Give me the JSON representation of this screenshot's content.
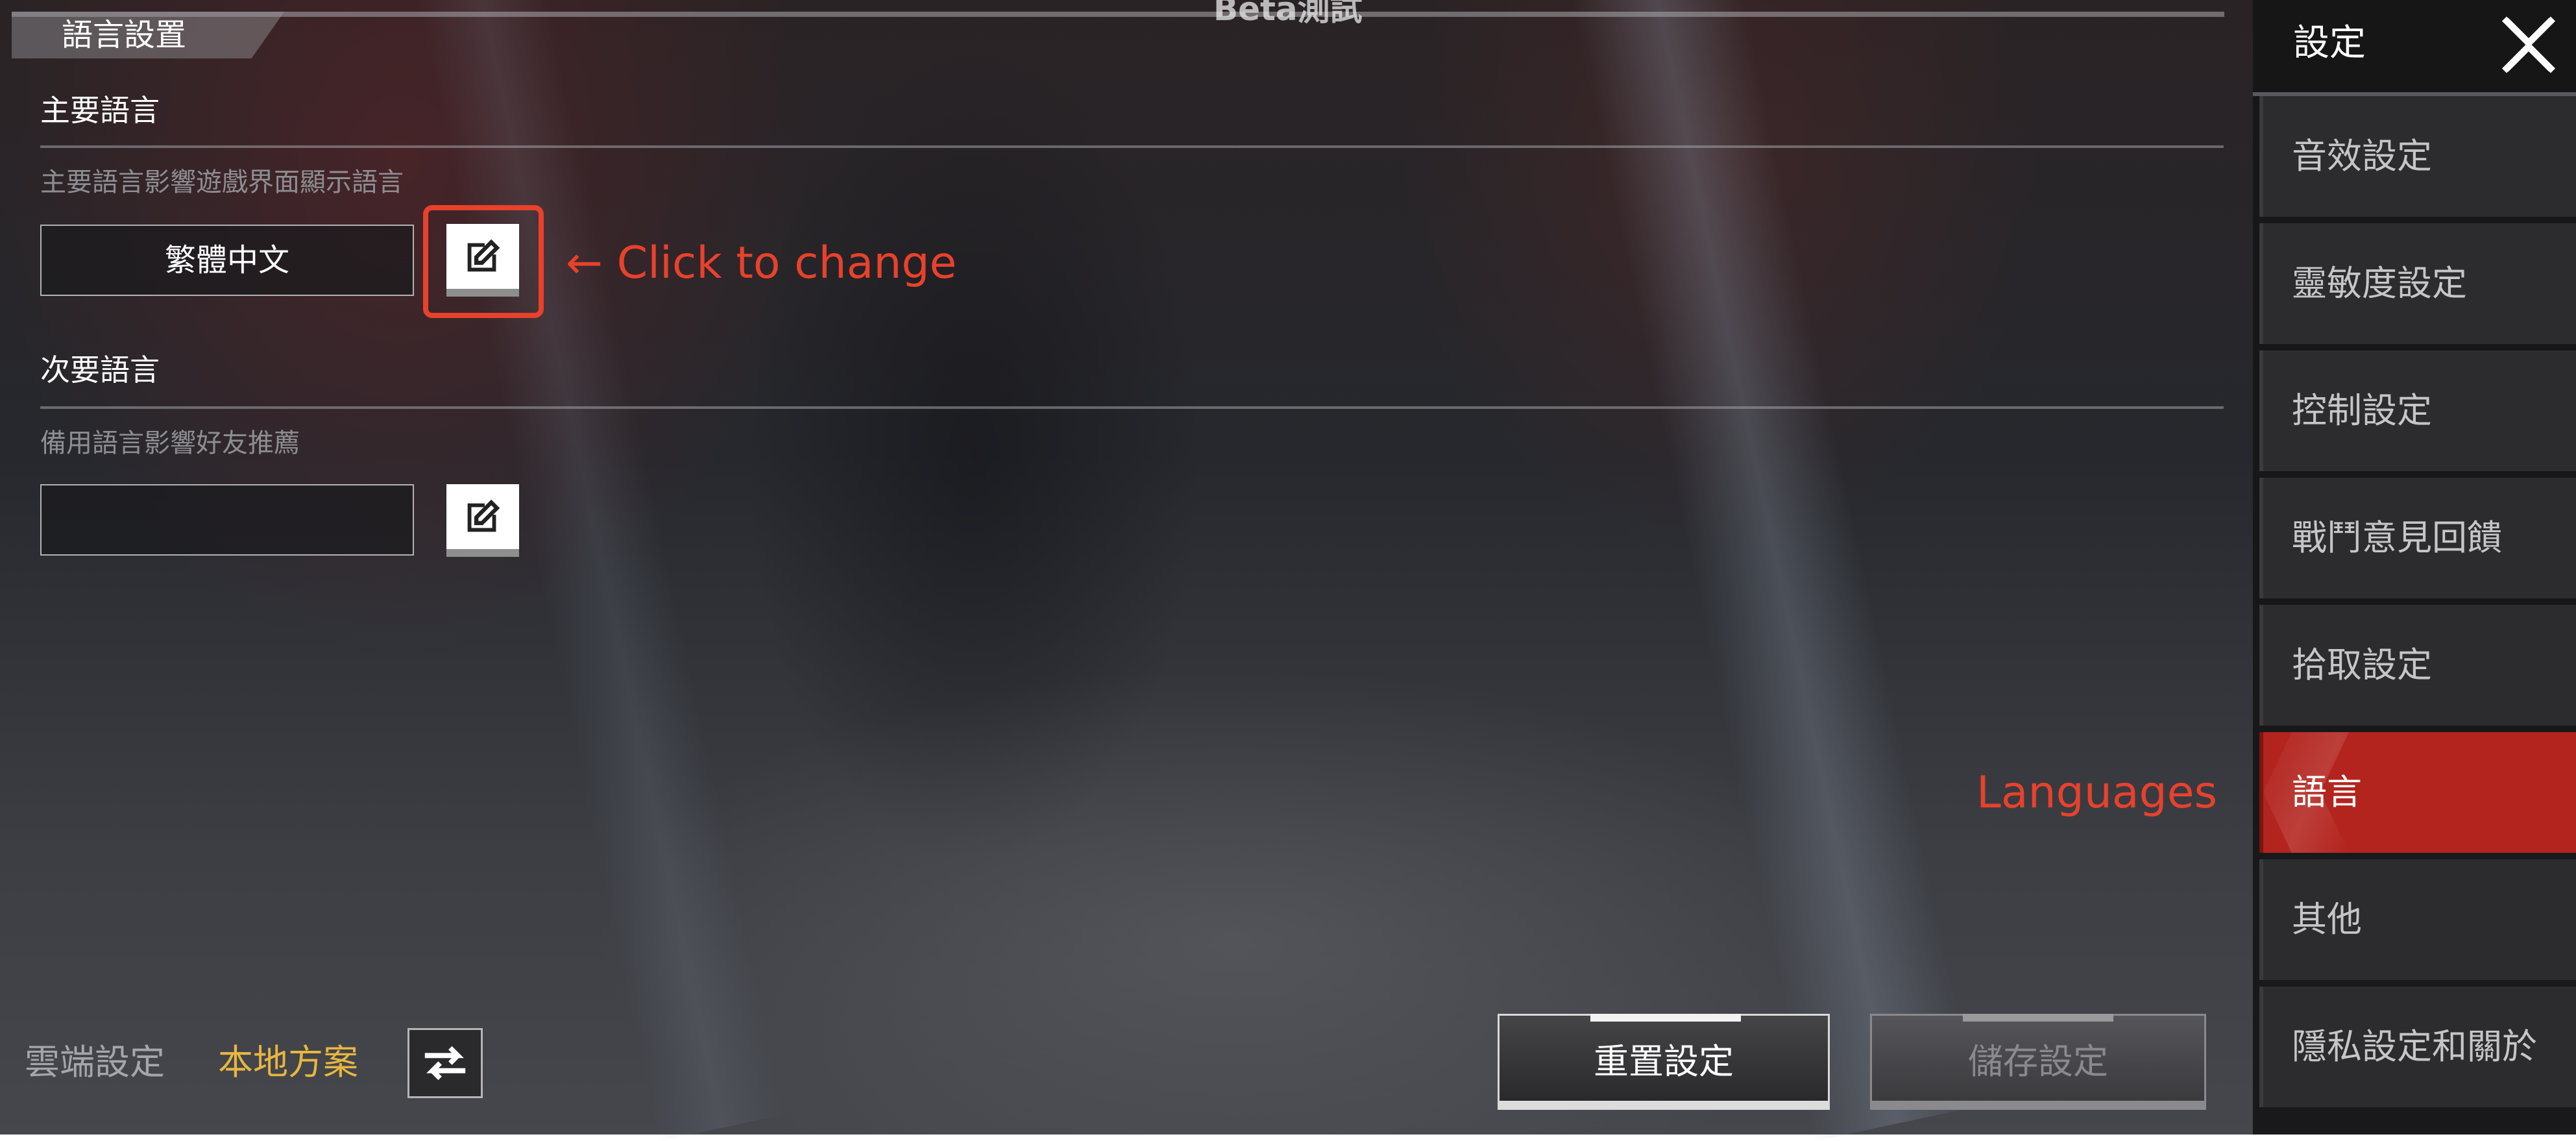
{
  "header": {
    "title": "語言設置",
    "beta_label": "Beta測試"
  },
  "primary_language": {
    "title": "主要語言",
    "description": "主要語言影響遊戲界面顯示語言",
    "value": "繁體中文"
  },
  "secondary_language": {
    "title": "次要語言",
    "description": "備用語言影響好友推薦",
    "value": ""
  },
  "annotations": {
    "click_to_change": "← Click to change",
    "languages": "Languages",
    "color": "#e8412c"
  },
  "bottom_bar": {
    "cloud_label": "雲端設定",
    "local_label": "本地方案",
    "reset_label": "重置設定",
    "save_label": "儲存設定"
  },
  "sidebar": {
    "title": "設定",
    "items": [
      {
        "label": "音效設定",
        "active": false
      },
      {
        "label": "靈敏度設定",
        "active": false
      },
      {
        "label": "控制設定",
        "active": false
      },
      {
        "label": "戰鬥意見回饋",
        "active": false
      },
      {
        "label": "拾取設定",
        "active": false
      },
      {
        "label": "語言",
        "active": true
      },
      {
        "label": "其他",
        "active": false
      },
      {
        "label": "隱私設定和關於",
        "active": false
      }
    ],
    "active_color": "#b3241e"
  },
  "icons": {
    "edit": "edit-icon",
    "swap": "swap-arrows-icon",
    "close": "close-icon"
  }
}
